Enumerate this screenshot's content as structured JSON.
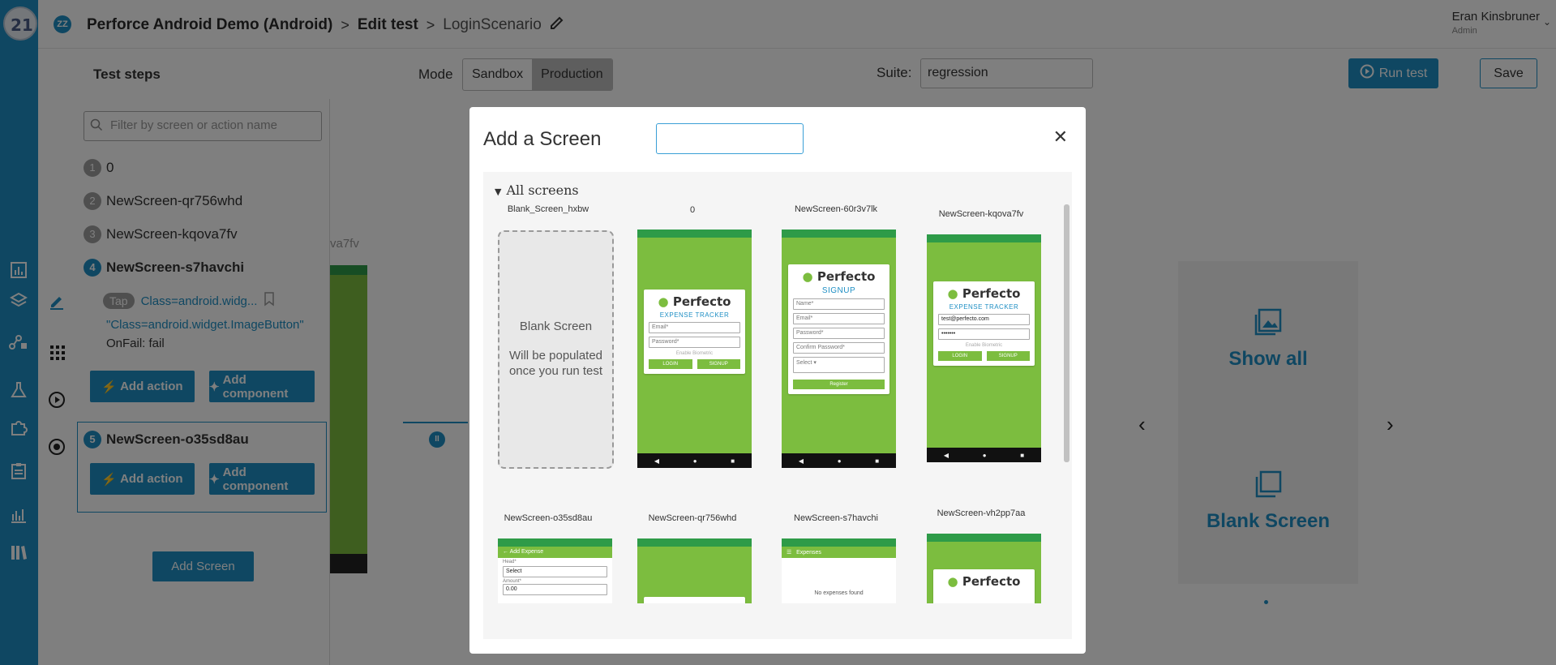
{
  "rail": {
    "logo_text": "21",
    "icons": [
      "chart-icon",
      "layers-icon",
      "steps-flow-icon",
      "edit-icon",
      "apps-grid-icon",
      "flask-icon",
      "play-circle-icon",
      "puzzle-icon",
      "record-icon",
      "checklist-icon",
      "bar-chart-icon",
      "library-icon"
    ]
  },
  "header": {
    "brand_icon": "ZZ",
    "crumb_project": "Perforce Android Demo (Android)",
    "crumb_sep": ">",
    "crumb_edit": "Edit test",
    "crumb_test": "LoginScenario",
    "user_name": "Eran Kinsbruner",
    "user_role": "Admin"
  },
  "toolbar": {
    "steps_title": "Test steps",
    "mode_label": "Mode",
    "mode_options": [
      "Sandbox",
      "Production"
    ],
    "mode_selected": "Production",
    "suite_label": "Suite:",
    "suite_value": "regression",
    "run_label": "Run test",
    "save_label": "Save"
  },
  "steps_panel": {
    "filter_placeholder": "Filter by screen or action name",
    "steps": [
      {
        "num": "1",
        "name": "0"
      },
      {
        "num": "2",
        "name": "NewScreen-qr756whd"
      },
      {
        "num": "3",
        "name": "NewScreen-kqova7fv"
      },
      {
        "num": "4",
        "name": "NewScreen-s7havchi"
      },
      {
        "num": "5",
        "name": "NewScreen-o35sd8au"
      }
    ],
    "action": {
      "type": "Tap",
      "locator_short": "Class=android.widg...",
      "locator_full": "\"Class=android.widget.ImageButton\"",
      "onfail": "OnFail: fail"
    },
    "add_action": "Add action",
    "add_component": "Add component",
    "add_screen": "Add Screen"
  },
  "canvas": {
    "label_partial": "va7fv",
    "show_all": "Show all",
    "blank_screen": "Blank Screen"
  },
  "modal": {
    "title": "Add a Screen",
    "search_value": "",
    "section": "All screens",
    "blank_card_title": "Blank Screen",
    "blank_card_desc": "Will be populated once you run test",
    "screens": [
      {
        "name": "Blank_Screen_hxbw"
      },
      {
        "name": "0"
      },
      {
        "name": "NewScreen-60r3v7lk"
      },
      {
        "name": "NewScreen-kqova7fv"
      },
      {
        "name": "NewScreen-o35sd8au"
      },
      {
        "name": "NewScreen-qr756whd"
      },
      {
        "name": "NewScreen-s7havchi"
      },
      {
        "name": "NewScreen-vh2pp7aa"
      }
    ],
    "app": {
      "logo": "Perfecto",
      "expense_tracker": "EXPENSE TRACKER",
      "signup": "SIGNUP",
      "email": "Email*",
      "password": "Password*",
      "name": "Name*",
      "confirm_password": "Confirm Password*",
      "select_currency": "Select Currency",
      "select": "Select",
      "biometric": "Enable Biometric",
      "login": "LOGIN",
      "signup_btn": "SIGNUP",
      "register": "Register",
      "email_value": "test@perfecto.com",
      "password_value": "•••••••",
      "add_expense": "Add Expense",
      "head_label": "Head*",
      "amount_label": "Amount*",
      "amount_value": "0.00",
      "expenses": "Expenses",
      "no_expenses": "No expenses found"
    }
  },
  "colors": {
    "accent": "#1f8fc4",
    "app_green": "#7cbd3f",
    "status_green": "#2e9b48"
  }
}
